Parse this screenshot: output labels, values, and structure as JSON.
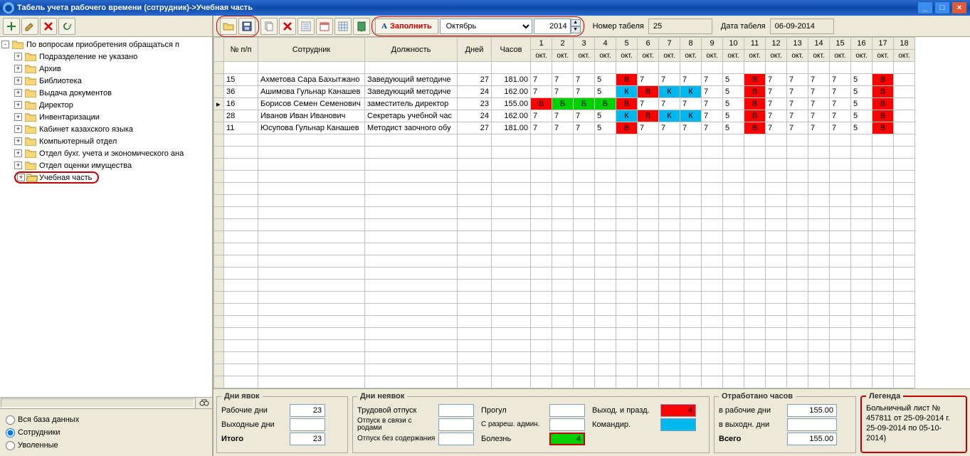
{
  "title": "Табель учета рабочего времени (сотрудник)->Учебная часть",
  "toolbar": {
    "fill_label": "Заполнить",
    "month": "Октябрь",
    "year": "2014",
    "num_label": "Номер табеля",
    "num_value": "25",
    "date_label": "Дата табеля",
    "date_value": "06-09-2014"
  },
  "tree": {
    "root": "По вопросам приобретения обращаться п",
    "items": [
      "Подразделение не указано",
      "Архив",
      "Библиотека",
      "Выдача документов",
      "Директор",
      "Инвентаризации",
      "Кабинет казахского языка",
      "Компьютерный отдел",
      "Отдел бухг. учета и экономического ана",
      "Отдел оценки имущества",
      "Учебная часть"
    ],
    "selected_index": 10
  },
  "radios": {
    "all": "Вся база данных",
    "emp": "Сотрудники",
    "fired": "Уволенные",
    "selected": "emp"
  },
  "grid": {
    "headers": {
      "rownum": "№ п/п",
      "emp": "Сотрудник",
      "pos": "Должность",
      "days": "Дней",
      "hours": "Часов"
    },
    "day_label": "окт.",
    "days": [
      1,
      2,
      3,
      4,
      5,
      6,
      7,
      8,
      9,
      10,
      11,
      12,
      13,
      14,
      15,
      16,
      17,
      18
    ],
    "rows": [
      {
        "n": "15",
        "emp": "Ахметова Сара Бахытжано",
        "pos": "Заведующий методиче",
        "d": 27,
        "h": "181.00",
        "c": [
          "7",
          "7",
          "7",
          "5",
          "В",
          "7",
          "7",
          "7",
          "7",
          "5",
          "В",
          "7",
          "7",
          "7",
          "7",
          "5",
          "В",
          ""
        ]
      },
      {
        "n": "36",
        "emp": "Ашимова Гульнар Канашев",
        "pos": "Заведующий методиче",
        "d": 24,
        "h": "162.00",
        "c": [
          "7",
          "7",
          "7",
          "5",
          "К",
          "В",
          "К",
          "К",
          "7",
          "5",
          "В",
          "7",
          "7",
          "7",
          "7",
          "5",
          "В",
          ""
        ]
      },
      {
        "n": "16",
        "emp": "Борисов Семен Семенович",
        "pos": "заместитель директор",
        "d": 23,
        "h": "155.00",
        "marker": true,
        "c": [
          "В",
          "Б",
          "Б",
          "Б",
          "В",
          "7",
          "7",
          "7",
          "7",
          "5",
          "В",
          "7",
          "7",
          "7",
          "7",
          "5",
          "В",
          ""
        ]
      },
      {
        "n": "28",
        "emp": "Иванов Иван Иванович",
        "pos": "Секретарь учебной час",
        "d": 24,
        "h": "162.00",
        "c": [
          "7",
          "7",
          "7",
          "5",
          "К",
          "В",
          "К",
          "К",
          "7",
          "5",
          "В",
          "7",
          "7",
          "7",
          "7",
          "5",
          "В",
          ""
        ]
      },
      {
        "n": "11",
        "emp": "Юсупова Гульнар Канашев",
        "pos": "Методист заочного обу",
        "d": 27,
        "h": "181.00",
        "c": [
          "7",
          "7",
          "7",
          "5",
          "В",
          "7",
          "7",
          "7",
          "7",
          "5",
          "В",
          "7",
          "7",
          "7",
          "7",
          "5",
          "В",
          ""
        ]
      }
    ]
  },
  "footer": {
    "attend": {
      "title": "Дни явок",
      "work": "Рабочие дни",
      "work_v": "23",
      "off": "Выходные дни",
      "off_v": "",
      "total": "Итого",
      "total_v": "23"
    },
    "absent": {
      "title": "Дни неявок",
      "vac": "Трудовой отпуск",
      "vac_v": "",
      "mat": "Отпуск в связи с родами",
      "mat_v": "",
      "unpaid": "Отпуск без содержания",
      "unpaid_v": "",
      "absent2": "Прогул",
      "absent2_v": "",
      "admin": "С разреш. админ.",
      "admin_v": "",
      "sick": "Болезнь",
      "sick_v": "4",
      "hol": "Выход. и празд.",
      "hol_v": "4",
      "trip": "Командир.",
      "trip_v": ""
    },
    "worked": {
      "title": "Отработано часов",
      "wd": "в рабочие дни",
      "wd_v": "155.00",
      "od": "в выходн. дни",
      "od_v": "",
      "total": "Всего",
      "total_v": "155.00"
    },
    "legend": {
      "title": "Легенда",
      "text": "Больничный лист № 457811 от 25-09-2014 г. 25-09-2014 по 05-10-2014)"
    }
  }
}
